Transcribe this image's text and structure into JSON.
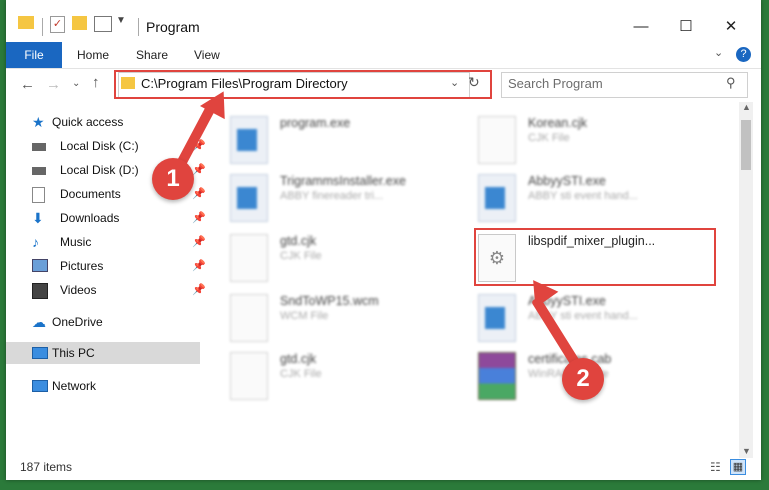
{
  "window": {
    "title": "Program",
    "minimize": "—",
    "maximize": "☐",
    "close": "✕"
  },
  "ribbon": {
    "file": "File",
    "home": "Home",
    "share": "Share",
    "view": "View",
    "help": "?"
  },
  "address": {
    "path": "C:\\Program Files\\Program Directory"
  },
  "search": {
    "placeholder": "Search Program"
  },
  "sidebar": {
    "quick_access": "Quick access",
    "items": [
      "Local Disk (C:)",
      "Local Disk (D:)",
      "Documents",
      "Downloads",
      "Music",
      "Pictures",
      "Videos"
    ],
    "onedrive": "OneDrive",
    "thispc": "This PC",
    "network": "Network"
  },
  "files": [
    {
      "name": "program.exe",
      "type": ""
    },
    {
      "name": "Korean.cjk",
      "type": "CJK File"
    },
    {
      "name": "TrigrammsInstaller.exe",
      "type": "ABBY finereader tri..."
    },
    {
      "name": "AbbyySTI.exe",
      "type": "ABBY sti event hand..."
    },
    {
      "name": "gtd.cjk",
      "type": "CJK File"
    },
    {
      "name": "libspdif_mixer_plugin...",
      "type": ""
    },
    {
      "name": "SndToWP15.wcm",
      "type": "WCM File"
    },
    {
      "name": "AbbyySTI.exe",
      "type": "ABBY sti event hand..."
    },
    {
      "name": "gtd.cjk",
      "type": "CJK File"
    },
    {
      "name": "certificates.cab",
      "type": "WinRAR archive"
    }
  ],
  "status": {
    "count": "187 items"
  },
  "annotations": {
    "one": "1",
    "two": "2",
    "color": "#e0443e"
  }
}
